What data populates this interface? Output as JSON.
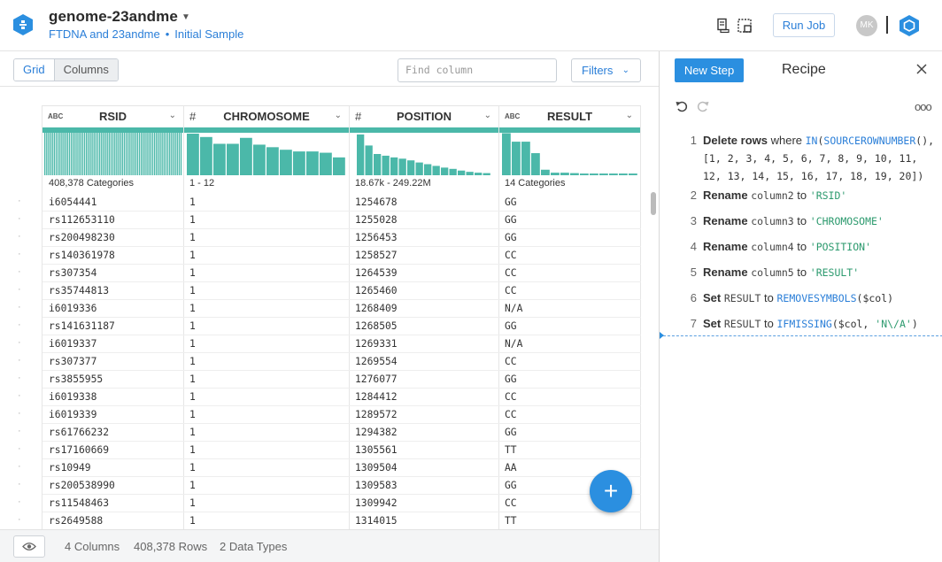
{
  "header": {
    "dataset_title": "genome-23andme",
    "breadcrumb_flow": "FTDNA and 23andme",
    "breadcrumb_dot": "•",
    "breadcrumb_sample": "Initial Sample",
    "run_job_label": "Run Job",
    "avatar_initials": "MK"
  },
  "toolbar": {
    "grid_label": "Grid",
    "columns_label": "Columns",
    "find_column_placeholder": "Find column",
    "filters_label": "Filters"
  },
  "columns": [
    {
      "type": "ABC",
      "name": "RSID",
      "summary": "408,378 Categories"
    },
    {
      "type": "#",
      "name": "CHROMOSOME",
      "summary": "1 - 12"
    },
    {
      "type": "#",
      "name": "POSITION",
      "summary": "18.67k - 249.22M"
    },
    {
      "type": "ABC",
      "name": "RESULT",
      "summary": "14 Categories"
    }
  ],
  "histograms": {
    "rsid": [
      1,
      1,
      1,
      1,
      1,
      1,
      1,
      1,
      1,
      1,
      1,
      1,
      1,
      1,
      1,
      1,
      1,
      1,
      1,
      1,
      1,
      1,
      1,
      1,
      1,
      1,
      1,
      1,
      1,
      1,
      1,
      1,
      1,
      1,
      1,
      1,
      1,
      1,
      1,
      1,
      1,
      1,
      1,
      1,
      1,
      1,
      1,
      1,
      1,
      1,
      1,
      1,
      1,
      1,
      1,
      1,
      1,
      1,
      1,
      1,
      1,
      1,
      1,
      1,
      1,
      1,
      1,
      1,
      1,
      1,
      1,
      1,
      1
    ],
    "chromosome": [
      0.98,
      0.9,
      0.74,
      0.74,
      0.88,
      0.72,
      0.66,
      0.6,
      0.56,
      0.56,
      0.53,
      0.42
    ],
    "position": [
      0.96,
      0.7,
      0.5,
      0.46,
      0.42,
      0.39,
      0.35,
      0.3,
      0.26,
      0.22,
      0.18,
      0.15,
      0.11,
      0.08,
      0.06,
      0.05
    ],
    "result": [
      0.99,
      0.79,
      0.79,
      0.52,
      0.13,
      0.06,
      0.06,
      0.05,
      0.04,
      0.04,
      0.04,
      0.04,
      0.04,
      0.04
    ]
  },
  "rows": [
    [
      "i6054441",
      "1",
      "1254678",
      "GG"
    ],
    [
      "rs112653110",
      "1",
      "1255028",
      "GG"
    ],
    [
      "rs200498230",
      "1",
      "1256453",
      "GG"
    ],
    [
      "rs140361978",
      "1",
      "1258527",
      "CC"
    ],
    [
      "rs307354",
      "1",
      "1264539",
      "CC"
    ],
    [
      "rs35744813",
      "1",
      "1265460",
      "CC"
    ],
    [
      "i6019336",
      "1",
      "1268409",
      "N/A"
    ],
    [
      "rs141631187",
      "1",
      "1268505",
      "GG"
    ],
    [
      "i6019337",
      "1",
      "1269331",
      "N/A"
    ],
    [
      "rs307377",
      "1",
      "1269554",
      "CC"
    ],
    [
      "rs3855955",
      "1",
      "1276077",
      "GG"
    ],
    [
      "i6019338",
      "1",
      "1284412",
      "CC"
    ],
    [
      "i6019339",
      "1",
      "1289572",
      "CC"
    ],
    [
      "rs61766232",
      "1",
      "1294382",
      "GG"
    ],
    [
      "rs17160669",
      "1",
      "1305561",
      "TT"
    ],
    [
      "rs10949",
      "1",
      "1309504",
      "AA"
    ],
    [
      "rs200538990",
      "1",
      "1309583",
      "GG"
    ],
    [
      "rs11548463",
      "1",
      "1309942",
      "CC"
    ],
    [
      "rs2649588",
      "1",
      "1314015",
      "TT"
    ]
  ],
  "row_marker": "·",
  "footer": {
    "columns": "4 Columns",
    "rows": "408,378 Rows",
    "types": "2 Data Types"
  },
  "fab_label": "+",
  "recipe": {
    "new_step_label": "New Step",
    "title": "Recipe",
    "more_label": "ooo",
    "steps": [
      {
        "num": "1",
        "kw": "Delete rows",
        "p1": " where ",
        "fn1": "IN",
        "p2": "(",
        "fn2": "SOURCEROWNUMBER",
        "p3": "(),",
        "p4": "[1, 2, 3, 4, 5, 6, 7, 8, 9, 10, 11, 12, 13, 14, 15, 16, 17, 18, 19, 20])"
      },
      {
        "num": "2",
        "kw": "Rename",
        "col": "column2",
        "to": "to",
        "val": "'RSID'"
      },
      {
        "num": "3",
        "kw": "Rename",
        "col": "column3",
        "to": "to",
        "val": "'CHROMOSOME'"
      },
      {
        "num": "4",
        "kw": "Rename",
        "col": "column4",
        "to": "to",
        "val": "'POSITION'"
      },
      {
        "num": "5",
        "kw": "Rename",
        "col": "column5",
        "to": "to",
        "val": "'RESULT'"
      },
      {
        "num": "6",
        "kw": "Set",
        "col": "RESULT",
        "to": "to",
        "fn": "REMOVESYMBOLS",
        "args": "($col)"
      },
      {
        "num": "7",
        "kw": "Set",
        "col": "RESULT",
        "to": "to",
        "fn": "IFMISSING",
        "a1": "($col, ",
        "sv": "'N\\/A'",
        "a2": ")"
      }
    ]
  },
  "colors": {
    "accent": "#2b8fe0",
    "link": "#2b7fd8",
    "histogram": "#4bb8a9",
    "string_literal": "#2c9a6e"
  },
  "icons": [
    "hexagon-logo-icon",
    "chevron-down-icon",
    "flow-view-icon",
    "layout-icon",
    "user-avatar",
    "hex-settings-icon",
    "close-icon",
    "undo-icon",
    "redo-icon",
    "more-icon",
    "eye-icon",
    "plus-icon"
  ]
}
